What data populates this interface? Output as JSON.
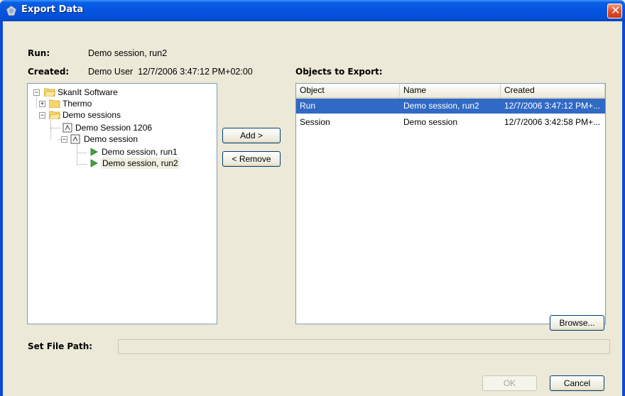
{
  "window": {
    "title": "Export Data",
    "close_glyph": "✕"
  },
  "run": {
    "label": "Run:",
    "value": "Demo session, run2"
  },
  "created": {
    "label": "Created:",
    "value": "Demo User  12/7/2006 3:47:12 PM+02:00"
  },
  "objects_label": "Objects to Export:",
  "tree": {
    "root": "SkanIt Software",
    "thermo": "Thermo",
    "demo_sessions": "Demo sessions",
    "demo_session_1206": "Demo Session 1206",
    "demo_session": "Demo session",
    "run1": "Demo session, run1",
    "run2": "Demo session, run2"
  },
  "buttons": {
    "add": "Add >",
    "remove": "< Remove",
    "browse": "Browse...",
    "ok": "OK",
    "cancel": "Cancel"
  },
  "list": {
    "columns": [
      "Object",
      "Name",
      "Created"
    ],
    "rows": [
      {
        "object": "Run",
        "name": "Demo session, run2",
        "created": "12/7/2006 3:47:12 PM+...",
        "selected": true
      },
      {
        "object": "Session",
        "name": "Demo session",
        "created": "12/7/2006 3:42:58 PM+...",
        "selected": false
      }
    ]
  },
  "file_path": {
    "label": "Set File Path:",
    "value": ""
  },
  "colors": {
    "title_bar": "#0553e0",
    "selection": "#316ac5",
    "dialog_bg": "#ece9d8"
  }
}
